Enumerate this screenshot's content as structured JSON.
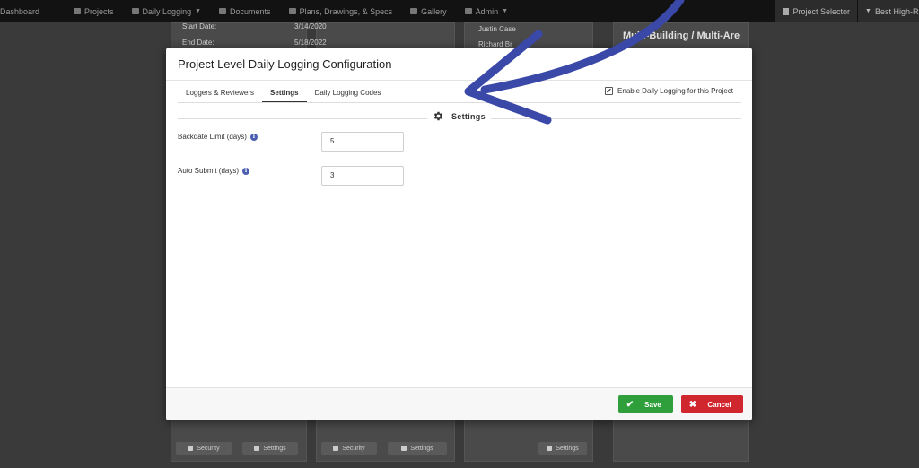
{
  "topnav": {
    "items": [
      {
        "label": "Dashboard",
        "icon": "home-icon"
      },
      {
        "label": "Projects",
        "icon": "projects-icon"
      },
      {
        "label": "Daily Logging",
        "icon": "daily-logging-icon",
        "dropdown": true
      },
      {
        "label": "Documents",
        "icon": "folder-icon"
      },
      {
        "label": "Plans, Drawings, & Specs",
        "icon": "plans-icon"
      },
      {
        "label": "Gallery",
        "icon": "gallery-icon"
      },
      {
        "label": "Admin",
        "icon": "admin-icon",
        "dropdown": true
      }
    ],
    "project_selector": "Project Selector",
    "current_project": "Best High-Rise"
  },
  "background": {
    "rows": [
      {
        "label": "Start Date:",
        "value": "3/14/2020"
      },
      {
        "label": "End Date:",
        "value": "5/18/2022"
      }
    ],
    "users": [
      "Justin Case",
      "Richard Br"
    ],
    "panel_title": "Multi-Building / Multi-Area",
    "security_label": "Security",
    "settings_label": "Settings"
  },
  "modal": {
    "title": "Project Level Daily Logging Configuration",
    "tabs": [
      {
        "label": "Loggers & Reviewers",
        "active": false
      },
      {
        "label": "Settings",
        "active": true
      },
      {
        "label": "Daily Logging Codes",
        "active": false
      }
    ],
    "enable_label": "Enable Daily Logging for this Project",
    "enable_checked": true,
    "section_title": "Settings",
    "fields": {
      "backdate": {
        "label": "Backdate Limit (days)",
        "value": "5"
      },
      "auto_submit": {
        "label": "Auto Submit (days)",
        "value": "3"
      }
    },
    "save_label": "Save",
    "cancel_label": "Cancel"
  },
  "colors": {
    "save": "#2e9f3b",
    "cancel": "#d0262e",
    "info": "#4a5fb0",
    "arrow": "#3a48a8"
  }
}
